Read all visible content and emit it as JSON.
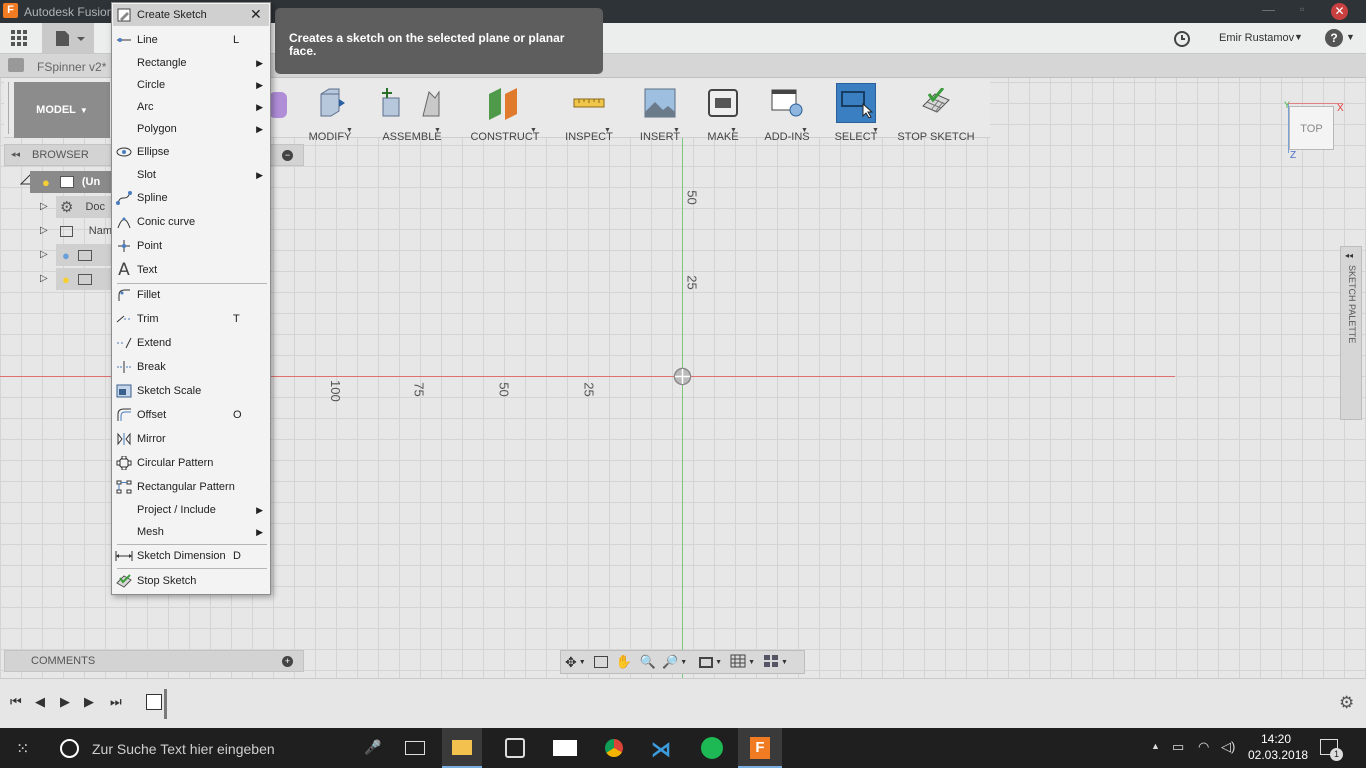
{
  "window": {
    "title": "Autodesk Fusion 360"
  },
  "topbar": {
    "user_name": "Emir Rustamov",
    "help": "?"
  },
  "document_tab": {
    "name": "FSpinner v2*"
  },
  "ribbon": {
    "workspace": "MODEL",
    "groups": [
      "MODIFY",
      "ASSEMBLE",
      "CONSTRUCT",
      "INSPECT",
      "INSERT",
      "MAKE",
      "ADD-INS",
      "SELECT",
      "STOP SKETCH"
    ]
  },
  "browser": {
    "title": "BROWSER",
    "items": [
      "(Un",
      "Doc",
      "Nam",
      "",
      ""
    ]
  },
  "comments": {
    "title": "COMMENTS"
  },
  "viewcube": {
    "face": "TOP",
    "x_axis": "X",
    "y_axis": "Y",
    "z_axis": "Z"
  },
  "sketch_palette": {
    "title": "SKETCH PALETTE"
  },
  "axis_labels": {
    "v50": "50",
    "v25": "25",
    "h100": "100",
    "h75": "75",
    "h50": "50",
    "h25": "25"
  },
  "tooltip": {
    "text": "Creates a sketch on the selected plane or planar face."
  },
  "menu": {
    "title": "Create Sketch",
    "items": [
      {
        "label": "Line",
        "shortcut": "L",
        "icon": "line-icon"
      },
      {
        "label": "Rectangle",
        "submenu": true
      },
      {
        "label": "Circle",
        "submenu": true
      },
      {
        "label": "Arc",
        "submenu": true
      },
      {
        "label": "Polygon",
        "submenu": true
      },
      {
        "label": "Ellipse",
        "icon": "ellipse-icon"
      },
      {
        "label": "Slot",
        "submenu": true
      },
      {
        "label": "Spline",
        "icon": "spline-icon"
      },
      {
        "label": "Conic curve",
        "icon": "conic-icon"
      },
      {
        "label": "Point",
        "icon": "point-icon"
      },
      {
        "label": "Text",
        "icon": "text-icon"
      },
      {
        "label": "Fillet",
        "icon": "fillet-icon"
      },
      {
        "label": "Trim",
        "shortcut": "T",
        "icon": "trim-icon"
      },
      {
        "label": "Extend",
        "icon": "extend-icon"
      },
      {
        "label": "Break",
        "icon": "break-icon"
      },
      {
        "label": "Sketch Scale",
        "icon": "scale-icon"
      },
      {
        "label": "Offset",
        "shortcut": "O",
        "icon": "offset-icon"
      },
      {
        "label": "Mirror",
        "icon": "mirror-icon"
      },
      {
        "label": "Circular Pattern",
        "icon": "circular-pattern-icon"
      },
      {
        "label": "Rectangular Pattern",
        "icon": "rectangular-pattern-icon"
      },
      {
        "label": "Project / Include",
        "submenu": true
      },
      {
        "label": "Mesh",
        "submenu": true
      },
      {
        "label": "Sketch Dimension",
        "shortcut": "D",
        "icon": "dimension-icon"
      },
      {
        "label": "Stop Sketch",
        "icon": "stop-sketch-icon"
      }
    ]
  },
  "taskbar": {
    "search_placeholder": "Zur Suche Text hier eingeben",
    "time": "14:20",
    "date": "02.03.2018",
    "notification_count": "1"
  },
  "colors": {
    "accent_select": "#3a7fc1",
    "x_axis": "#e04040",
    "y_axis": "#3fb03f"
  }
}
